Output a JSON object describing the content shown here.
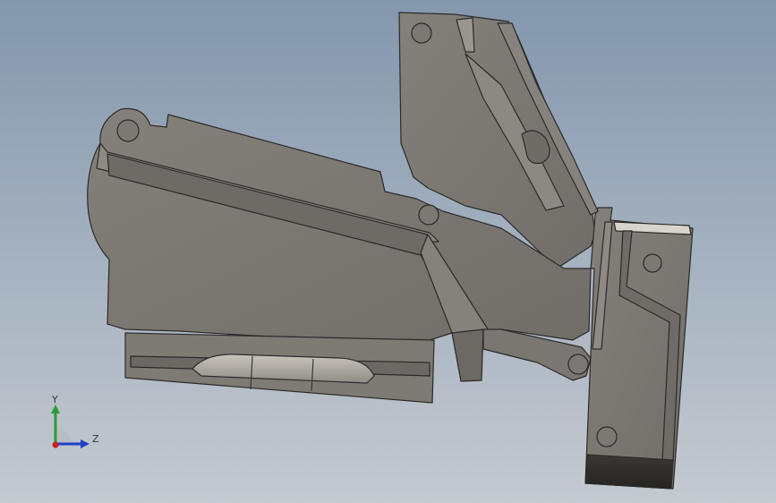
{
  "viewport": {
    "background_top": "#8497ad",
    "background_bottom": "#c4cacf"
  },
  "model": {
    "body_color": "#7a7671",
    "edge_color": "#2c2b2a",
    "highlight_color": "#d8d4cc"
  },
  "triad": {
    "y_label": "Y",
    "z_label": "Z",
    "y_color": "#2a9a3a",
    "z_color": "#2340c8",
    "x_color": "#c81e1e"
  }
}
